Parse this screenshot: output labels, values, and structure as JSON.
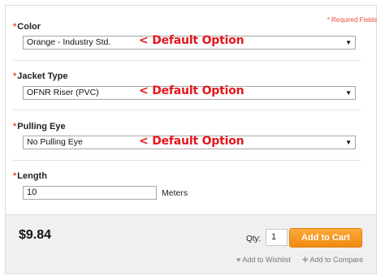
{
  "required_note": "* Required Fields",
  "groups": [
    {
      "label": "Color",
      "value": "Orange - Industry Std.",
      "annotation": "< Default Option"
    },
    {
      "label": "Jacket Type",
      "value": "OFNR Riser (PVC)",
      "annotation": "< Default Option"
    },
    {
      "label": "Pulling Eye",
      "value": "No Pulling Eye",
      "annotation": "< Default Option"
    }
  ],
  "length": {
    "label": "Length",
    "value": "10",
    "unit": "Meters"
  },
  "footer": {
    "price": "$9.84",
    "qty_label": "Qty:",
    "qty_value": "1",
    "add_to_cart": "Add to Cart",
    "wishlist": "Add to Wishlist",
    "compare": "Add to Compare"
  },
  "colors": {
    "accent": "#f39a1f",
    "required": "#e84c3d",
    "annotation": "#e3171d"
  },
  "icons": {
    "dropdown": "chevron-down-icon",
    "wishlist": "heart-icon",
    "compare": "plus-icon"
  }
}
